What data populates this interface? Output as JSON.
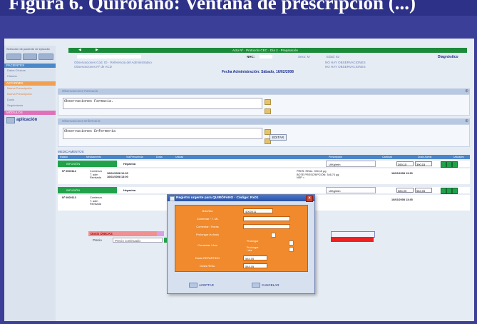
{
  "slide": {
    "title": "Figura 6. Quirófano: Ventana de prescripción (...)"
  },
  "sidebar": {
    "intro": "Selección de paciente de episodio",
    "section_patient": "PACIENTES",
    "items_patient": [
      "Datos Clínicos",
      "Historia"
    ],
    "section_action": "ACCIONES",
    "items_action": [
      "Nueva Prescripción",
      "Nueva Prescripción",
      "Dosis",
      "Seguimiento"
    ],
    "section_modules": "MÓDULOS",
    "app_label": "aplicación"
  },
  "header": {
    "green_text": "Acto Nº · Protocolo CEC · Día 2 · Preparación",
    "nhc_label": "NHC:",
    "sexo": "Sexo:  M",
    "edad": "Edad:  62",
    "diagnostico": "Diagnóstico",
    "obs_left_1": "Observaciones Cód. ID · Referencia del Administrativo",
    "obs_left_2": "Observaciones Nº de ACD",
    "obs_right_1": "NO HAY OBSERVACIONES",
    "obs_right_2": "NO HAY OBSERVACIONES"
  },
  "fecha": "Fecha Administración: Sábado, 16/02/2008",
  "panels": {
    "farmacia_head": "Observaciones Farmacia",
    "farmacia_text": "Observaciones Farmacia.",
    "enfermeria_head": "Observaciones Enfermería",
    "enfermeria_text": "Observaciones Enfermería",
    "editar": "EDITAR"
  },
  "table": {
    "title": "MEDICAMENTOS",
    "headers": [
      "Estado",
      "Medicamento",
      "Vía/Frecuencia",
      "Dosis",
      "Unidad",
      "Prescripción",
      "Cantidad",
      "Dosis Admin",
      "Unidades"
    ],
    "row1": {
      "status": "INFUSIÓN",
      "name": "Heparina",
      "detail_left": "Nº 0000112",
      "detail_mid": "Comienzo\nT. adm\nRevisada",
      "detail_dates": "16/02/2008 12:00\n16/02/2008 13:00",
      "right_text": "PRES. REAL: 390,15 µg\nBOTE PRESCRIPCIÓN: 346,74 µg\nNEP =",
      "right_date": "16/02/2008 13:30",
      "unit": "U/Kg/min",
      "sel1": "390,15",
      "sel2": "390,15"
    },
    "row2": {
      "status": "INFUSIÓN",
      "name": "Heparina",
      "detail_left": "Nº 0000113",
      "detail_mid": "Comienzo\nT. adm\nRevisada",
      "right_text": "584,05 µg\n584,05 µg\n0,00",
      "right_date": "16/02/2008 13:45",
      "unit": "U/Kg/min",
      "sel1": "584,05",
      "sel2": "584,05"
    }
  },
  "lower": {
    "dosis_label": "Dosis ÚNICAS",
    "precio_label": "Precio",
    "precio_value": "Precio continuado"
  },
  "modal": {
    "title": "Registro urgente para QUIRÓFANO · Código: Rx01",
    "fields": [
      {
        "label": "Bolo/día",
        "value": "4000011"
      },
      {
        "label": "Comentar / T. ML",
        "value": ""
      },
      {
        "label": "Comentar / Horas",
        "value": ""
      },
      {
        "label": "Prolongar la dosis",
        "value": ""
      },
      {
        "label": "Comentar / Aux",
        "value": "Prolongar"
      },
      {
        "label": "",
        "value": "Prolongar / día"
      },
      {
        "label": "Dosis REPARTIDO",
        "value": "584,05"
      },
      {
        "label": "Dosis REAL",
        "value": "584,05"
      }
    ],
    "accept": "ACEPTAR",
    "cancel": "CANCELAR"
  }
}
